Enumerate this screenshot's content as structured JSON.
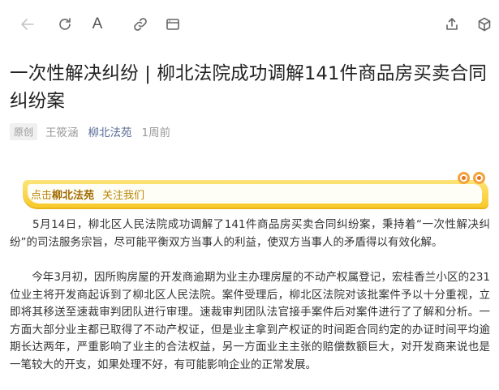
{
  "toolbar": {
    "back_icon": "arrow-left-icon",
    "refresh_icon": "refresh-icon",
    "font_label": "A",
    "link_icon": "link-icon",
    "window_icon": "browser-window-icon",
    "share_icon": "share-icon",
    "cube_icon": "cube-icon"
  },
  "article": {
    "title": "一次性解决纠纷 | 柳北法院成功调解141件商品房买卖合同纠纷案",
    "badge": "原创",
    "author": "王筱涵",
    "source": "柳北法苑",
    "time": "1周前"
  },
  "banner": {
    "prefix": "点击",
    "name": "柳北法苑",
    "follow": "关注我们"
  },
  "paragraphs": [
    "　　5月14日，柳北区人民法院成功调解了141件商品房买卖合同纠纷案，秉持着“一次性解决纠纷”的司法服务宗旨，尽可能平衡双方当事人的利益，使双方当事人的矛盾得以有效化解。",
    "　　今年3月初，因所购房屋的开发商逾期为业主办理房屋的不动产权属登记，宏桂香兰小区的231位业主将开发商起诉到了柳北区人民法院。案件受理后，柳北区法院对该批案件予以十分重视，立即将其移送至速裁审判团队进行审理。速裁审判团队法官接手案件后对案件进行了了解和分析。一方面大部分业主都已取得了不动产权证，但是业主拿到产权证的时间距合同约定的办证时间平均逾期长达两年，严重影响了业主的合法权益，另一方面业主主张的赔偿数额巨大，对开发商来说也是一笔较大的开支，如果处理不好，有可能影响企业的正常发展。"
  ],
  "colors": {
    "link": "#576b95",
    "banner_yellow": "#f8c928",
    "banner_text": "#a06a00",
    "dot_orange": "#f4a23b"
  }
}
